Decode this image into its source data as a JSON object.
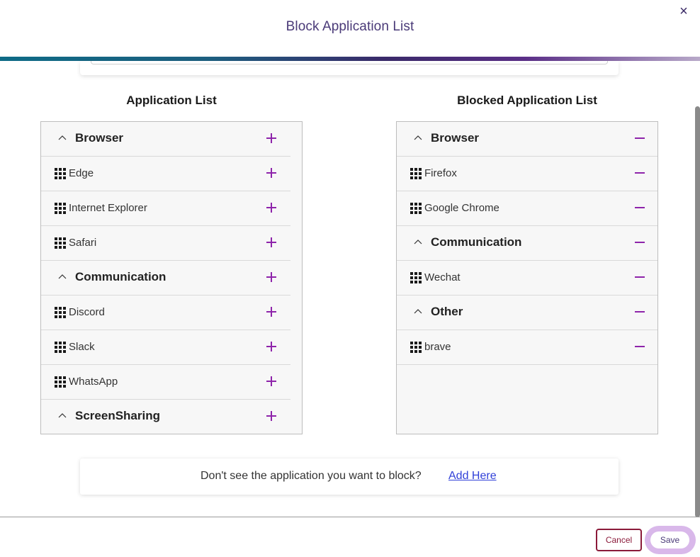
{
  "modal": {
    "title": "Block Application List",
    "close_label": "×"
  },
  "colors": {
    "accent_purple": "#8e24aa",
    "title_color": "#4a3a78",
    "cancel_color": "#8b1a3a",
    "link_color": "#2f3fd8"
  },
  "application_list": {
    "title": "Application List",
    "rows": [
      {
        "type": "group",
        "label": "Browser"
      },
      {
        "type": "item",
        "label": "Edge"
      },
      {
        "type": "item",
        "label": "Internet Explorer"
      },
      {
        "type": "item",
        "label": "Safari"
      },
      {
        "type": "group",
        "label": "Communication"
      },
      {
        "type": "item",
        "label": "Discord"
      },
      {
        "type": "item",
        "label": "Slack"
      },
      {
        "type": "item",
        "label": "WhatsApp"
      },
      {
        "type": "group",
        "label": "ScreenSharing"
      }
    ],
    "action_icon": "plus-icon"
  },
  "blocked_list": {
    "title": "Blocked Application List",
    "rows": [
      {
        "type": "group",
        "label": "Browser"
      },
      {
        "type": "item",
        "label": "Firefox"
      },
      {
        "type": "item",
        "label": "Google Chrome"
      },
      {
        "type": "group",
        "label": "Communication"
      },
      {
        "type": "item",
        "label": "Wechat"
      },
      {
        "type": "group",
        "label": "Other"
      },
      {
        "type": "item",
        "label": "brave"
      }
    ],
    "action_icon": "minus-icon"
  },
  "add_prompt": {
    "text": "Don't see the application you want to block?",
    "link": "Add Here"
  },
  "footer": {
    "cancel_label": "Cancel",
    "save_label": "Save"
  }
}
